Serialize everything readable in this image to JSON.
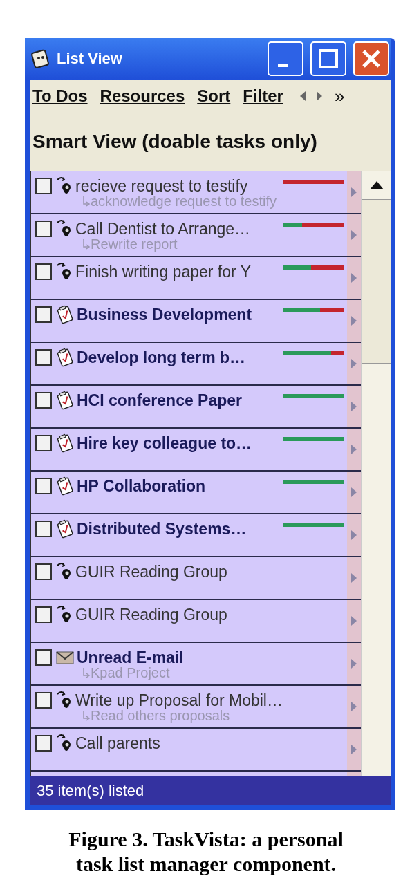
{
  "window": {
    "title": "List View"
  },
  "menu": [
    {
      "label": "To Dos"
    },
    {
      "label": "Resources"
    },
    {
      "label": "Sort"
    },
    {
      "label": "Filter"
    }
  ],
  "menu_more": "»",
  "view_title": "Smart View (doable tasks only)",
  "tasks": [
    {
      "kind": "recurring",
      "title": "recieve request to testify",
      "subtitle": "acknowledge request to testify",
      "bold": false,
      "checked": false,
      "level": 0
    },
    {
      "kind": "recurring",
      "title": "Call  Dentist  to  Arrange…",
      "subtitle": "Rewrite report",
      "bold": false,
      "checked": false,
      "level": 0.3
    },
    {
      "kind": "recurring",
      "title": "Finish writing paper for Y",
      "bold": false,
      "checked": false,
      "level": 0.45
    },
    {
      "kind": "project",
      "title": "Business Development",
      "bold": true,
      "checked": false,
      "level": 0.6
    },
    {
      "kind": "project",
      "title": "Develop  long  term  b…",
      "bold": true,
      "checked": false,
      "level": 0.78
    },
    {
      "kind": "project",
      "title": "HCI conference Paper",
      "bold": true,
      "checked": false,
      "level": 1
    },
    {
      "kind": "project",
      "title": "Hire  key  colleague  to…",
      "bold": true,
      "checked": false,
      "level": 1
    },
    {
      "kind": "project",
      "title": "HP Collaboration",
      "bold": true,
      "checked": false,
      "level": 1
    },
    {
      "kind": "project",
      "title": "Distributed  Systems…",
      "bold": true,
      "checked": false,
      "level": 1
    },
    {
      "kind": "recurring",
      "title": "GUIR Reading Group",
      "bold": false,
      "checked": false
    },
    {
      "kind": "recurring",
      "title": "GUIR Reading Group",
      "bold": false,
      "checked": false
    },
    {
      "kind": "email",
      "title": "Unread E-mail",
      "subtitle": "Kpad Project",
      "bold": true,
      "checked": false
    },
    {
      "kind": "recurring",
      "title": "Write  up  Proposal  for  Mobil…",
      "subtitle": "Read others proposals",
      "bold": false,
      "checked": false
    },
    {
      "kind": "recurring",
      "title": "Call parents",
      "bold": false,
      "checked": false
    }
  ],
  "status_bar": "35 item(s) listed",
  "caption": "Figure 3. TaskVista: a personal task list manager component."
}
